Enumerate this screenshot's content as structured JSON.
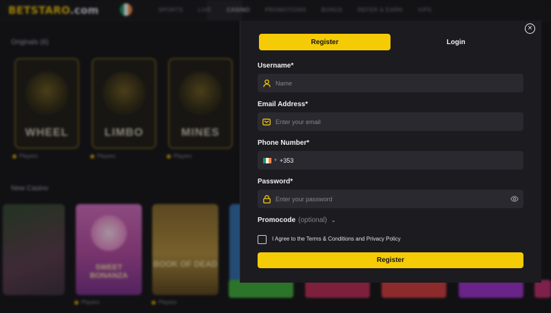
{
  "site": {
    "logo_primary": "BETSTARO",
    "logo_suffix": ".com",
    "nav": [
      "SPORTS",
      "LIVE",
      "CASINO",
      "PROMOTIONS",
      "BONUS",
      "REFER & EARN",
      "VIPS"
    ],
    "sections": {
      "originals": "Originals (6)",
      "casino": "New Casino"
    },
    "originals": [
      {
        "name": "WHEEL",
        "players": "Players"
      },
      {
        "name": "LIMBO",
        "players": "Players"
      },
      {
        "name": "MINES",
        "players": "Players"
      }
    ],
    "casino_cards": [
      "SWEET BONANZA",
      "BOOK OF DEAD"
    ],
    "casino_players": "Players"
  },
  "modal": {
    "tabs": {
      "register": "Register",
      "login": "Login"
    },
    "username": {
      "label": "Username*",
      "placeholder": "Name"
    },
    "email": {
      "label": "Email Address*",
      "placeholder": "Enter your email"
    },
    "phone": {
      "label": "Phone Number*",
      "code": "+353"
    },
    "password": {
      "label": "Password*",
      "placeholder": "Enter your password"
    },
    "promocode": {
      "label": "Promocode",
      "optional": "(optional)"
    },
    "agree": "I Agree to the Terms & Conditions and Privacy Policy",
    "submit": "Register",
    "close_symbol": "×"
  },
  "colors": {
    "accent": "#f5cb05",
    "panel": "#1c1b20",
    "field": "#2a2930",
    "flag_ie": [
      "#169b62",
      "#ffffff",
      "#ff883e"
    ]
  },
  "icons": [
    "user-icon",
    "mail-icon",
    "lock-icon",
    "eye-icon",
    "close-icon",
    "chevron-down-icon",
    "ireland-flag-icon"
  ]
}
